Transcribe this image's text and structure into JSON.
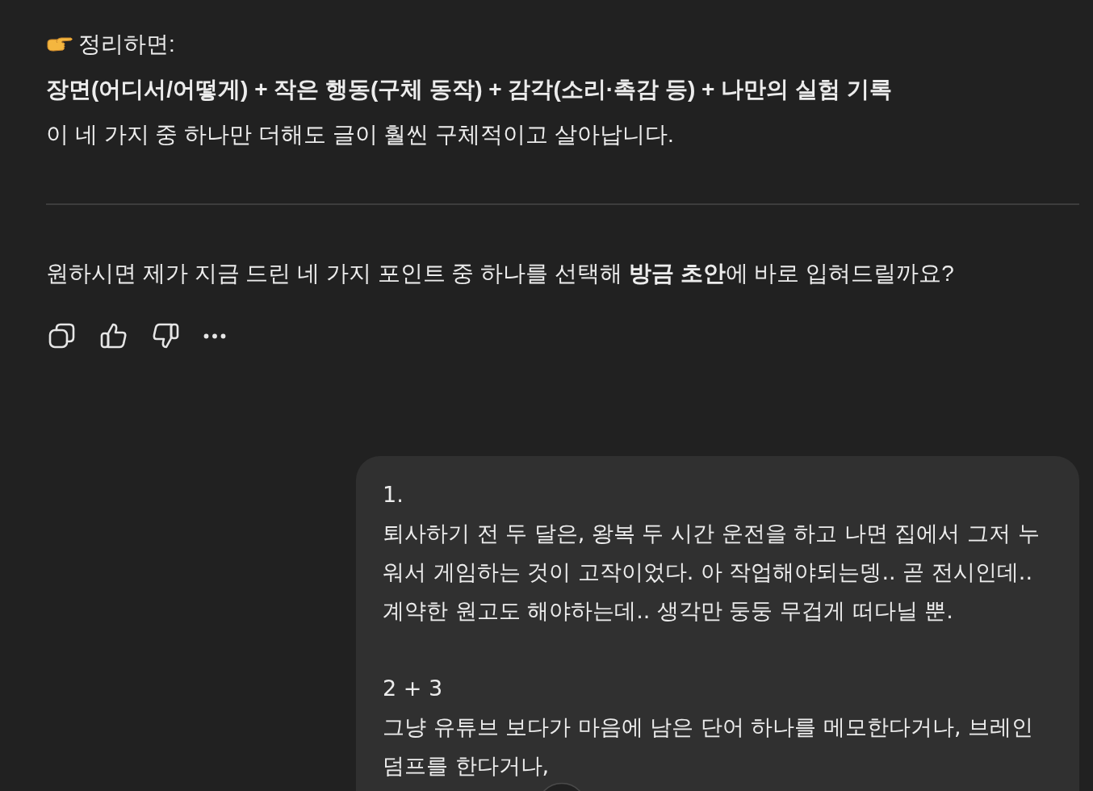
{
  "assistant_message": {
    "summary": {
      "label": "정리하면:",
      "formula": "장면(어디서/어떻게) + 작은 행동(구체 동작) + 감각(소리·촉감 등) + 나만의 실험 기록",
      "note": "이 네 가지 중 하나만 더해도 글이 훨씬 구체적이고 살아납니다."
    },
    "closing": "원하시면 제가 지금 드린 네 가지 포인트 중 하나를 선택해 **방금 초안**에 바로 입혀드릴까요?"
  },
  "user_message": {
    "blocks": [
      {
        "heading": "1.",
        "text": "퇴사하기 전 두 달은, 왕복 두 시간 운전을 하고 나면 집에서 그저 누워서 게임하는 것이 고작이었다. 아 작업해야되는뎅.. 곧 전시인데.. 계약한 원고도 해야하는데.. 생각만 둥둥 무겁게 떠다닐 뿐."
      },
      {
        "heading": "2 + 3",
        "text": "그냥 유튜브 보다가 마음에 남은 단어 하나를 메모한다거나, 브레인 덤프를 한다거나,"
      }
    ]
  }
}
